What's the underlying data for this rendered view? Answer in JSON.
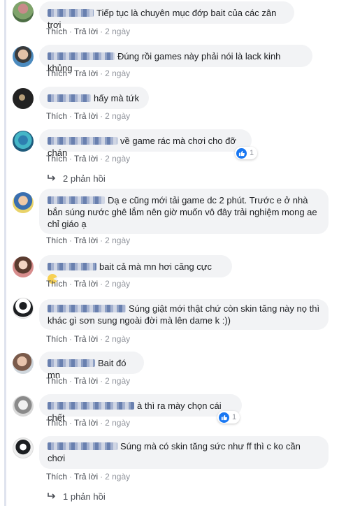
{
  "actions": {
    "like": "Thích",
    "reply": "Trả lời",
    "sep": "·"
  },
  "comments": [
    {
      "text": "Tiếp tục là chuyên mục đớp bait của các zân trơi",
      "time": "2 ngày"
    },
    {
      "text": "Đúng rồi games này phải nói là lack kinh khủng",
      "time": "2 ngày"
    },
    {
      "text": "hấy mà tứk",
      "time": "2 ngày"
    },
    {
      "text": "về game rác mà chơi cho đỡ chán",
      "time": "2 ngày",
      "reactions": "1"
    },
    {
      "text": "Dạ e cũng mới tải game dc 2 phút. Trước e ở nhà bắn súng nước ghê lắm nên giờ muốn vô đây trải nghiệm mong ae chỉ giáo ạ",
      "time": "2 ngày"
    },
    {
      "text": "bait cả mà mn hơi căng cực",
      "time": "2 ngày",
      "emoji": "pacman-emoji"
    },
    {
      "text": "Súng giật mới thật chứ còn skin tăng này nọ thì khác gì sơn sung ngoài đời mà lên dame k :))",
      "time": "2 ngày"
    },
    {
      "text": "Bait đó mn",
      "time": "2 ngày"
    },
    {
      "text": "à thì ra mày chọn cái chết",
      "time": "2 ngày",
      "reactions": "1"
    },
    {
      "text": "Súng mà có skin tăng sức như ff thì c ko cần chơi",
      "time": "2 ngày"
    }
  ],
  "reply_links": {
    "first": "2 phản hồi",
    "second": "1 phản hồi"
  },
  "colors": {
    "bubble": "#f2f3f5",
    "link": "#4b4f56",
    "meta": "#90949c",
    "like": "#1877f2",
    "thread": "#dfe3ee"
  }
}
